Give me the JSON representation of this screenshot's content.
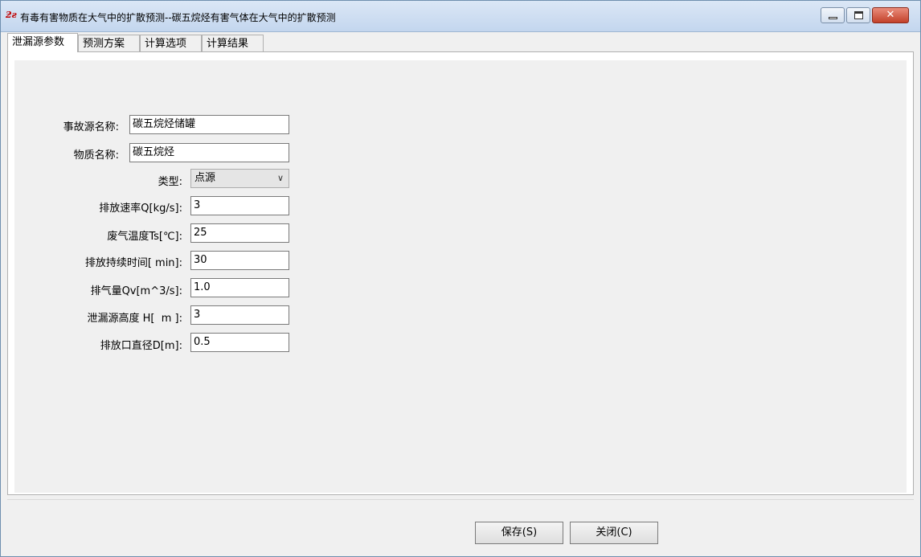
{
  "window": {
    "title": "有毒有害物质在大气中的扩散预测--碳五烷烃有害气体在大气中的扩散预测",
    "close_glyph": "✕"
  },
  "tabs": [
    {
      "label": "泄漏源参数"
    },
    {
      "label": "预测方案"
    },
    {
      "label": "计算选项"
    },
    {
      "label": "计算结果"
    }
  ],
  "form": {
    "accident_source_name": {
      "label": "事故源名称:",
      "value": "碳五烷烃储罐"
    },
    "substance_name": {
      "label": "物质名称:",
      "value": "碳五烷烃"
    },
    "type": {
      "label": "类型:",
      "value": "点源"
    },
    "emission_rate": {
      "label": "排放速率Q[kg/s]:",
      "value": "3"
    },
    "exhaust_temp": {
      "label": "废气温度Ts[℃]:",
      "value": "25"
    },
    "duration": {
      "label": "排放持续时间[ min]:",
      "value": "30"
    },
    "exhaust_volume": {
      "label": "排气量Qv[m^3/s]:",
      "value": "1.0"
    },
    "source_height": {
      "label": "泄漏源高度 H[  m ]:",
      "value": "3"
    },
    "outlet_diameter": {
      "label": "排放口直径D[m]:",
      "value": "0.5"
    }
  },
  "buttons": {
    "save": "保存(S)",
    "close": "关闭(C)"
  }
}
